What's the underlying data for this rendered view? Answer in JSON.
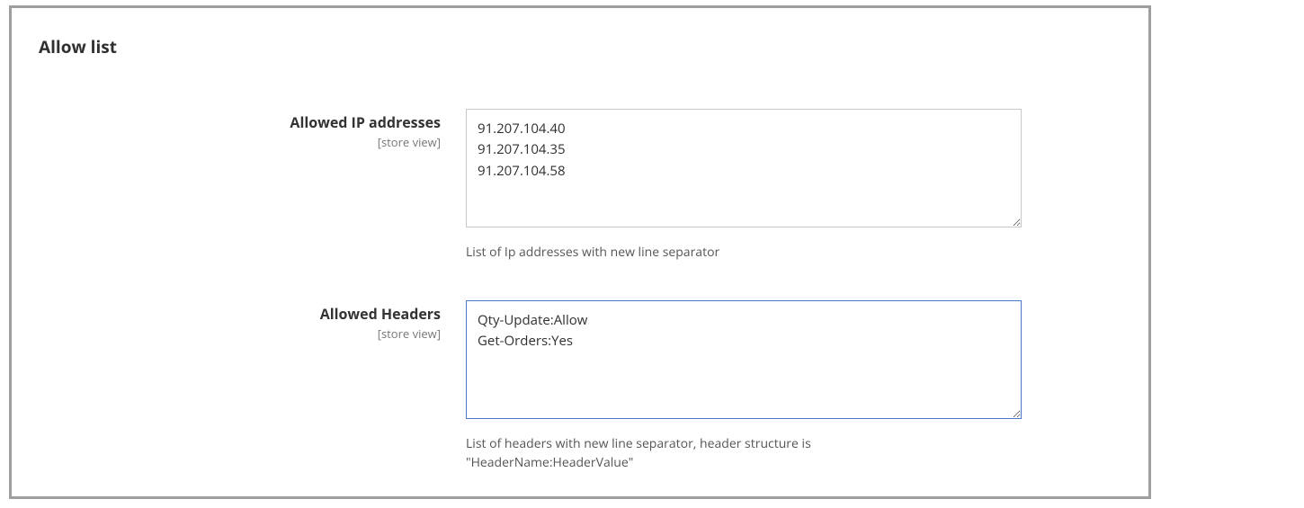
{
  "section": {
    "title": "Allow list"
  },
  "fields": {
    "allowed_ip": {
      "label": "Allowed IP addresses",
      "scope": "[store view]",
      "value": "91.207.104.40\n91.207.104.35\n91.207.104.58",
      "help": "List of Ip addresses with new line separator"
    },
    "allowed_headers": {
      "label": "Allowed Headers",
      "scope": "[store view]",
      "value": "Qty-Update:Allow\nGet-Orders:Yes",
      "help": "List of headers with new line separator, header structure is \"HeaderName:HeaderValue\""
    }
  }
}
